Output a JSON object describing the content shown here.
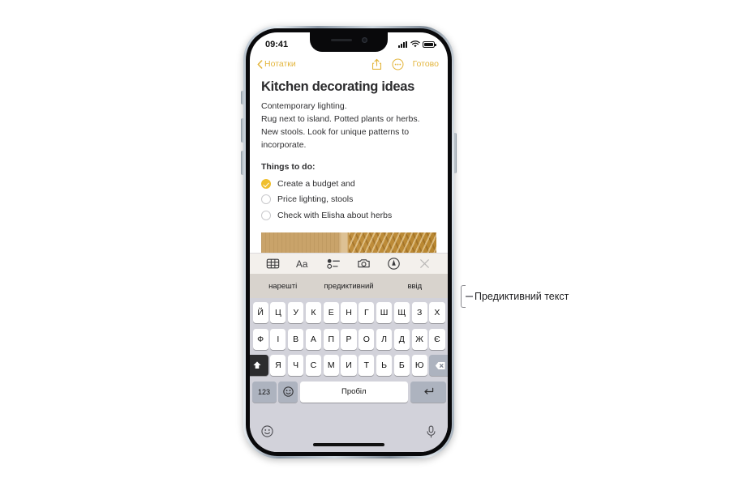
{
  "device": {
    "status_bar": {
      "time": "09:41",
      "signal_icon": "cellular-signal-icon",
      "wifi_icon": "wifi-icon",
      "battery_icon": "battery-full-icon"
    }
  },
  "nav_bar": {
    "back_label": "Нотатки",
    "back_icon": "chevron-left-icon",
    "share_icon": "share-icon",
    "more_icon": "more-circle-icon",
    "done_label": "Готово",
    "accent_color": "#e3b53c"
  },
  "note": {
    "title": "Kitchen decorating ideas",
    "paragraph": [
      "Contemporary lighting.",
      "Rug next to island.  Potted plants or herbs.",
      "New stools. Look for unique patterns to",
      "incorporate."
    ],
    "things_heading": "Things to do:",
    "checklist": [
      {
        "label": "Create a budget and",
        "checked": true
      },
      {
        "label": "Price lighting, stools",
        "checked": false
      },
      {
        "label": "Check with Elisha about herbs",
        "checked": false
      }
    ],
    "photo_alt": "note-attachment-photo"
  },
  "note_toolbar": {
    "items": [
      {
        "icon": "table-icon"
      },
      {
        "icon": "text-format-aa-icon"
      },
      {
        "icon": "checklist-icon"
      },
      {
        "icon": "camera-icon"
      },
      {
        "icon": "markup-pen-icon"
      },
      {
        "icon": "close-icon"
      }
    ]
  },
  "predictive_bar": {
    "suggestions": [
      "нарешті",
      "предиктивний",
      "ввід"
    ]
  },
  "keyboard": {
    "row1": [
      "Й",
      "Ц",
      "У",
      "К",
      "Е",
      "Н",
      "Г",
      "Ш",
      "Щ",
      "З",
      "Х"
    ],
    "row2": [
      "Ф",
      "І",
      "В",
      "А",
      "П",
      "Р",
      "О",
      "Л",
      "Д",
      "Ж",
      "Є"
    ],
    "row3": [
      "Я",
      "Ч",
      "С",
      "М",
      "И",
      "Т",
      "Ь",
      "Б",
      "Ю"
    ],
    "shift_icon": "shift-up-icon",
    "backspace_icon": "backspace-icon",
    "numbers_label": "123",
    "emoji_icon": "emoji-smiley-icon",
    "space_label": "Пробіл",
    "return_icon": "return-enter-icon",
    "bottom_emoji_icon": "emoji-smiley-icon",
    "bottom_mic_icon": "microphone-icon"
  },
  "annotation": {
    "text": "Предиктивний текст",
    "bracket_color": "#8b8b90"
  }
}
